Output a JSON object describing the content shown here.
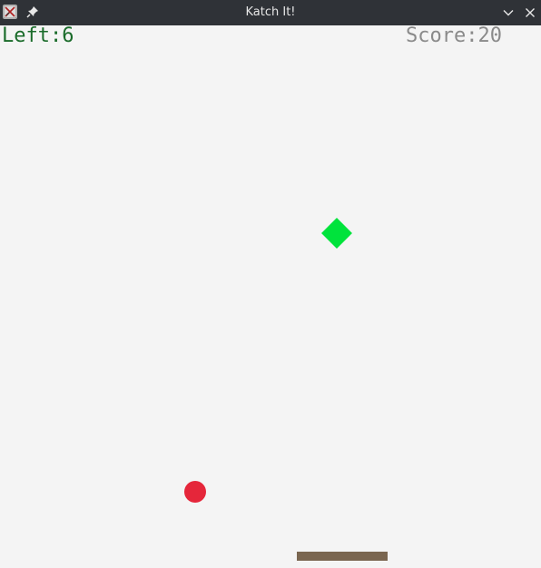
{
  "window": {
    "title": "Katch It!"
  },
  "hud": {
    "left_label": "Left:6",
    "score_label": "Score:20"
  },
  "colors": {
    "titlebar": "#2f3237",
    "background": "#f4f4f4",
    "left_text": "#1a6b2a",
    "score_text": "#8a8a8a",
    "diamond": "#00e33c",
    "ball": "#e5263a",
    "paddle": "#7a6650"
  },
  "icons": {
    "app": "app-icon",
    "pin": "pin-icon",
    "minimize": "chevron-down-icon",
    "close": "close-icon"
  }
}
